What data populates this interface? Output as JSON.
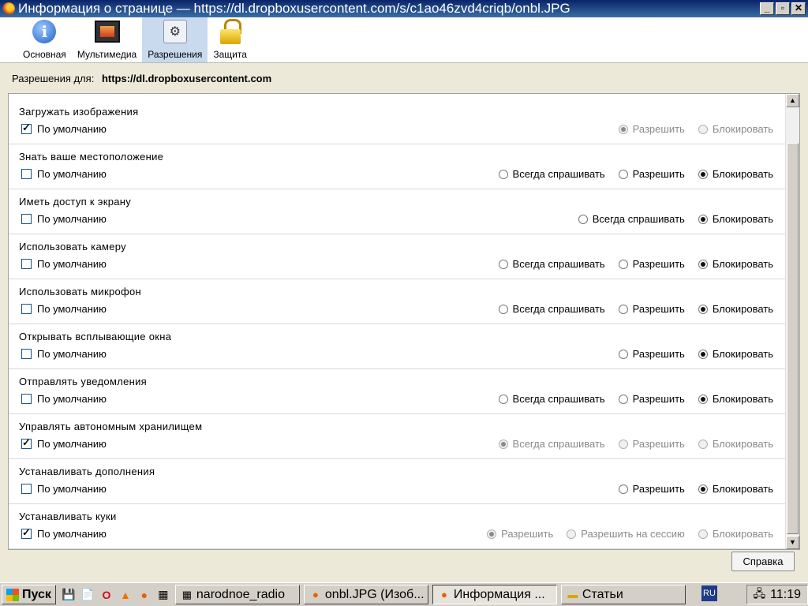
{
  "window": {
    "title": "Информация о странице — https://dl.dropboxusercontent.com/s/c1ao46zvd4criqb/onbl.JPG",
    "buttons": {
      "minimize": "_",
      "restore": "▫",
      "close": "✕"
    }
  },
  "toolbar": {
    "tabs": [
      {
        "label": "Основная",
        "icon": "info-icon"
      },
      {
        "label": "Мультимедиа",
        "icon": "media-icon"
      },
      {
        "label": "Разрешения",
        "icon": "permissions-icon",
        "active": true
      },
      {
        "label": "Защита",
        "icon": "lock-icon"
      }
    ]
  },
  "perm_for": {
    "label": "Разрешения для:",
    "host": "https://dl.dropboxusercontent.com"
  },
  "rows": [
    {
      "title": "Загружать изображения",
      "default_label": "По умолчанию",
      "default_checked": true,
      "disabled": true,
      "options": [
        {
          "label": "Разрешить",
          "selected": true
        },
        {
          "label": "Блокировать",
          "selected": false
        }
      ]
    },
    {
      "title": "Знать ваше местоположение",
      "default_label": "По умолчанию",
      "default_checked": false,
      "disabled": false,
      "options": [
        {
          "label": "Всегда спрашивать",
          "selected": false
        },
        {
          "label": "Разрешить",
          "selected": false
        },
        {
          "label": "Блокировать",
          "selected": true
        }
      ]
    },
    {
      "title": "Иметь доступ к экрану",
      "default_label": "По умолчанию",
      "default_checked": false,
      "disabled": false,
      "options": [
        {
          "label": "Всегда спрашивать",
          "selected": false
        },
        {
          "label": "Блокировать",
          "selected": true
        }
      ]
    },
    {
      "title": "Использовать камеру",
      "default_label": "По умолчанию",
      "default_checked": false,
      "disabled": false,
      "options": [
        {
          "label": "Всегда спрашивать",
          "selected": false
        },
        {
          "label": "Разрешить",
          "selected": false
        },
        {
          "label": "Блокировать",
          "selected": true
        }
      ]
    },
    {
      "title": "Использовать микрофон",
      "default_label": "По умолчанию",
      "default_checked": false,
      "disabled": false,
      "options": [
        {
          "label": "Всегда спрашивать",
          "selected": false
        },
        {
          "label": "Разрешить",
          "selected": false
        },
        {
          "label": "Блокировать",
          "selected": true
        }
      ]
    },
    {
      "title": "Открывать всплывающие окна",
      "default_label": "По умолчанию",
      "default_checked": false,
      "disabled": false,
      "options": [
        {
          "label": "Разрешить",
          "selected": false
        },
        {
          "label": "Блокировать",
          "selected": true
        }
      ]
    },
    {
      "title": "Отправлять уведомления",
      "default_label": "По умолчанию",
      "default_checked": false,
      "disabled": false,
      "options": [
        {
          "label": "Всегда спрашивать",
          "selected": false
        },
        {
          "label": "Разрешить",
          "selected": false
        },
        {
          "label": "Блокировать",
          "selected": true
        }
      ]
    },
    {
      "title": "Управлять автономным хранилищем",
      "default_label": "По умолчанию",
      "default_checked": true,
      "disabled": true,
      "options": [
        {
          "label": "Всегда спрашивать",
          "selected": true
        },
        {
          "label": "Разрешить",
          "selected": false
        },
        {
          "label": "Блокировать",
          "selected": false
        }
      ]
    },
    {
      "title": "Устанавливать дополнения",
      "default_label": "По умолчанию",
      "default_checked": false,
      "disabled": false,
      "options": [
        {
          "label": "Разрешить",
          "selected": false
        },
        {
          "label": "Блокировать",
          "selected": true
        }
      ]
    },
    {
      "title": "Устанавливать куки",
      "default_label": "По умолчанию",
      "default_checked": true,
      "disabled": true,
      "options": [
        {
          "label": "Разрешить",
          "selected": true
        },
        {
          "label": "Разрешить на сессию",
          "selected": false
        },
        {
          "label": "Блокировать",
          "selected": false
        }
      ]
    }
  ],
  "help_button": "Справка",
  "taskbar": {
    "start_label": "Пуск",
    "tasks": [
      {
        "label": "narodnoe_radio",
        "icon": "film-icon"
      },
      {
        "label": "onbl.JPG (Изоб...",
        "icon": "firefox-icon"
      },
      {
        "label": "Информация ...",
        "icon": "firefox-icon",
        "active": true
      },
      {
        "label": "Статьи",
        "icon": "folder-icon"
      }
    ],
    "lang": "RU",
    "clock": "11:19"
  }
}
